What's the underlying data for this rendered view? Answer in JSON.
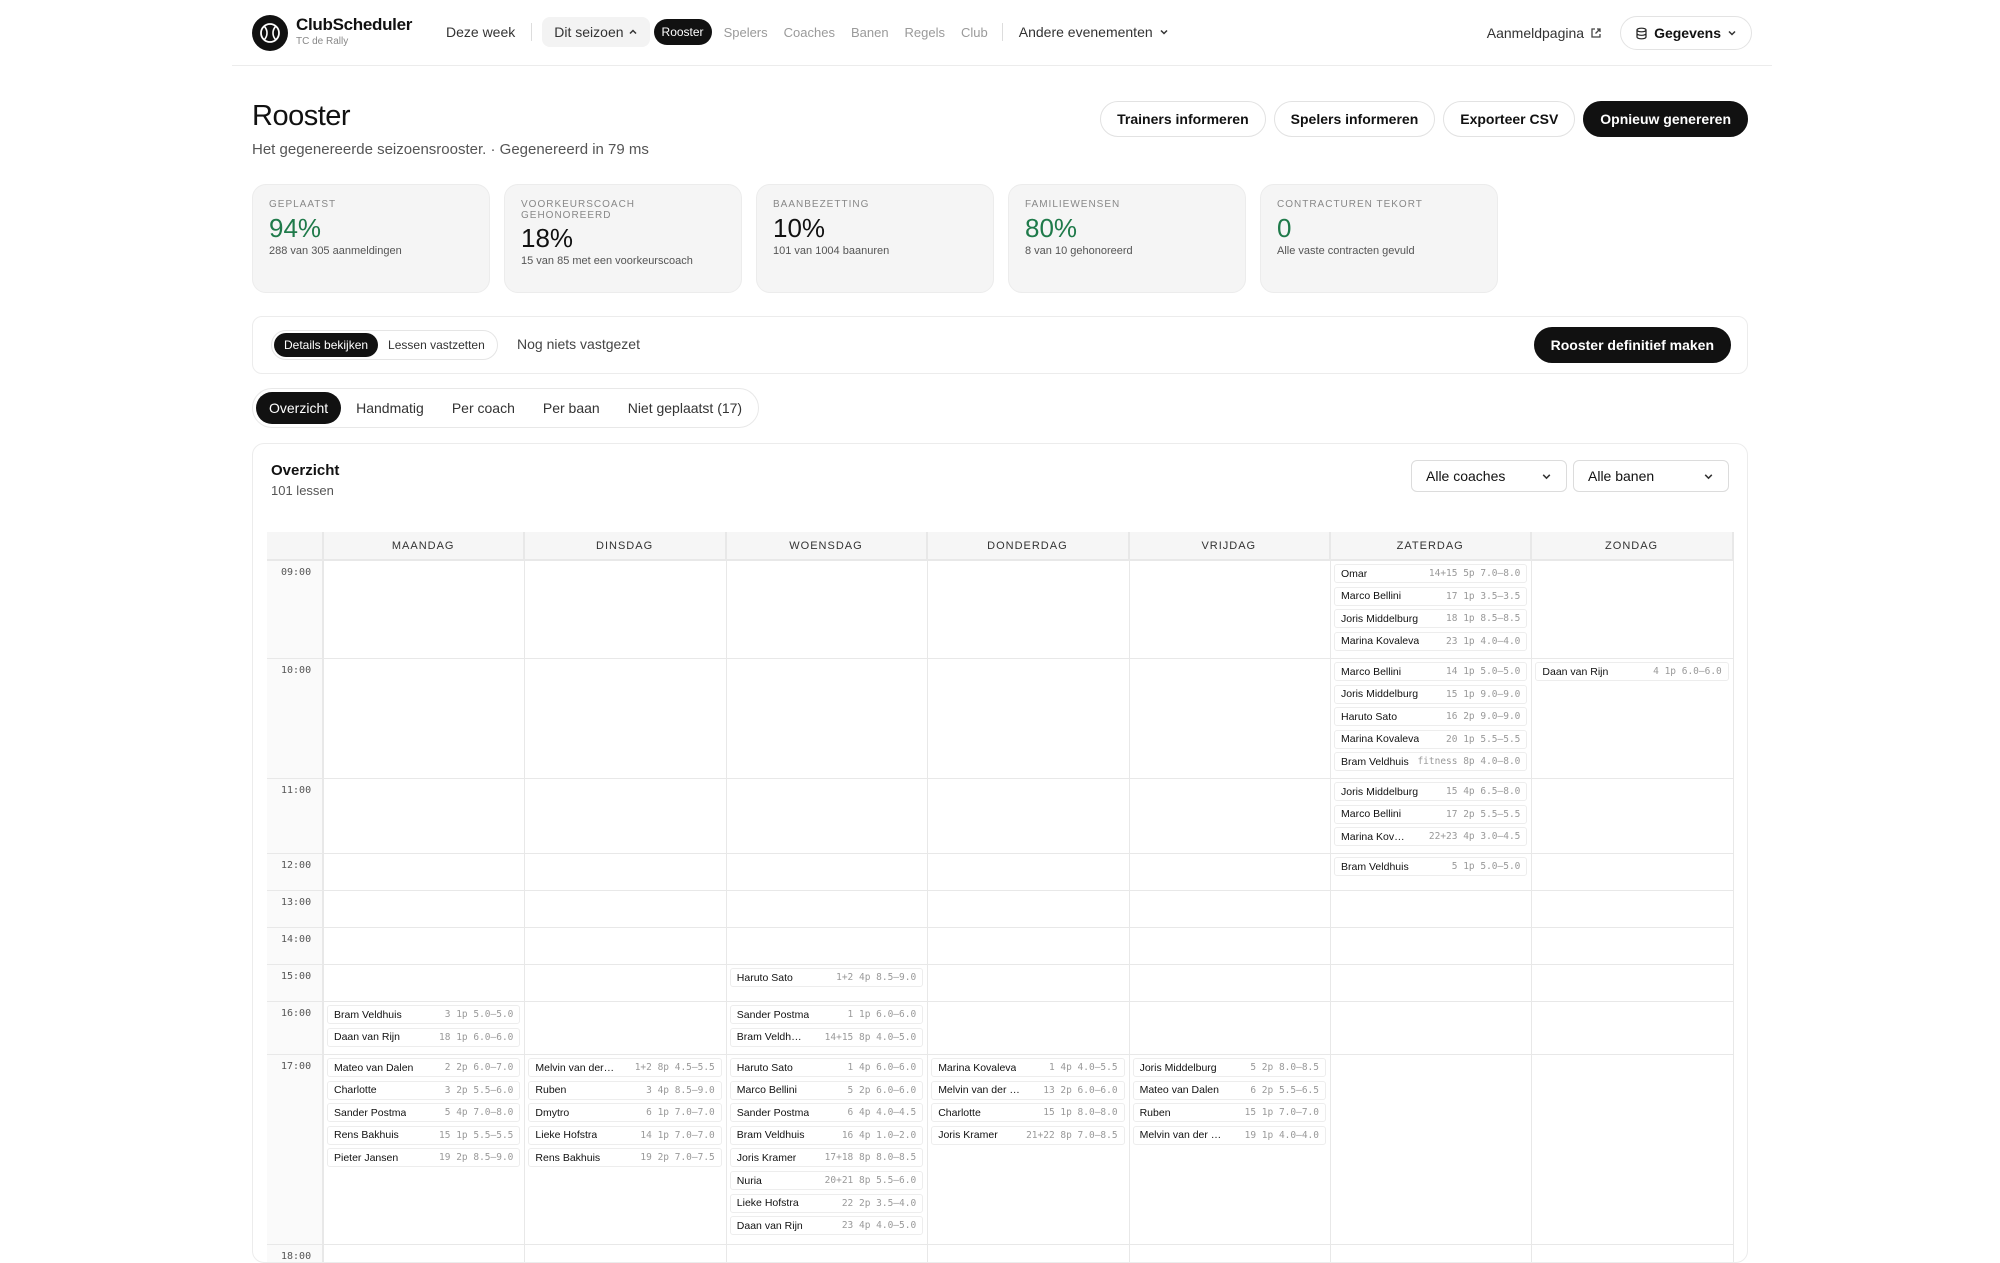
{
  "brand": {
    "name": "ClubScheduler",
    "sub": "TC de Rally"
  },
  "nav": {
    "this_week": "Deze week",
    "season": "Dit seizoen",
    "items": [
      "Rooster",
      "Spelers",
      "Coaches",
      "Banen",
      "Regels",
      "Club"
    ],
    "other_events": "Andere evenementen",
    "signup_page": "Aanmeldpagina",
    "data": "Gegevens"
  },
  "page": {
    "title": "Rooster",
    "subtitle": "Het gegenereerde seizoensrooster. · Gegenereerd in 79 ms",
    "actions": [
      "Trainers informeren",
      "Spelers informeren",
      "Exporteer CSV",
      "Opnieuw genereren"
    ]
  },
  "stats": [
    {
      "label": "Geplaatst",
      "value": "94%",
      "desc": "288 van 305 aanmeldingen",
      "color": "#1f7a4a"
    },
    {
      "label": "Voorkeurscoach gehonoreerd",
      "value": "18%",
      "desc": "15 van 85 met een voorkeurscoach",
      "color": "#111111"
    },
    {
      "label": "Baanbezetting",
      "value": "10%",
      "desc": "101 van 1004 baanuren",
      "color": "#111111"
    },
    {
      "label": "Familiewensen",
      "value": "80%",
      "desc": "8 van 10 gehonoreerd",
      "color": "#1f7a4a"
    },
    {
      "label": "Contracturen tekort",
      "value": "0",
      "desc": "Alle vaste contracten gevuld",
      "color": "#1f7a4a"
    }
  ],
  "lockbar": {
    "modes": [
      "Details bekijken",
      "Lessen vastzetten"
    ],
    "status": "Nog niets vastgezet",
    "finalize": "Rooster definitief maken"
  },
  "tabs": [
    "Overzicht",
    "Handmatig",
    "Per coach",
    "Per baan",
    "Niet geplaatst (17)"
  ],
  "overview": {
    "title": "Overzicht",
    "count": "101 lessen",
    "filter_coach": "Alle coaches",
    "filter_court": "Alle banen"
  },
  "calendar": {
    "days": [
      "MAANDAG",
      "DINSDAG",
      "WOENSDAG",
      "DONDERDAG",
      "VRIJDAG",
      "ZATERDAG",
      "ZONDAG"
    ],
    "times": [
      "09:00",
      "10:00",
      "11:00",
      "12:00",
      "13:00",
      "14:00",
      "15:00",
      "16:00",
      "17:00",
      "18:00"
    ],
    "lessons": [
      {
        "day": 5,
        "time": 0,
        "coach": "Omar",
        "meta": "14+15 5p 7.0–8.0"
      },
      {
        "day": 5,
        "time": 0,
        "coach": "Marco Bellini",
        "meta": "17 1p 3.5–3.5"
      },
      {
        "day": 5,
        "time": 0,
        "coach": "Joris Middelburg",
        "meta": "18 1p 8.5–8.5"
      },
      {
        "day": 5,
        "time": 0,
        "coach": "Marina Kovaleva",
        "meta": "23 1p 4.0–4.0"
      },
      {
        "day": 5,
        "time": 1,
        "coach": "Marco Bellini",
        "meta": "14 1p 5.0–5.0"
      },
      {
        "day": 5,
        "time": 1,
        "coach": "Joris Middelburg",
        "meta": "15 1p 9.0–9.0"
      },
      {
        "day": 5,
        "time": 1,
        "coach": "Haruto Sato",
        "meta": "16 2p 9.0–9.0"
      },
      {
        "day": 5,
        "time": 1,
        "coach": "Marina Kovaleva",
        "meta": "20 1p 5.5–5.5"
      },
      {
        "day": 5,
        "time": 1,
        "coach": "Bram Veldhuis",
        "meta": "fitness 8p 4.0–8.0"
      },
      {
        "day": 6,
        "time": 1,
        "coach": "Daan van Rijn",
        "meta": "4 1p 6.0–6.0"
      },
      {
        "day": 5,
        "time": 2,
        "coach": "Joris Middelburg",
        "meta": "15 4p 6.5–8.0"
      },
      {
        "day": 5,
        "time": 2,
        "coach": "Marco Bellini",
        "meta": "17 2p 5.5–5.5"
      },
      {
        "day": 5,
        "time": 2,
        "coach": "Marina Kov…",
        "meta": "22+23 4p 3.0–4.5"
      },
      {
        "day": 5,
        "time": 3,
        "coach": "Bram Veldhuis",
        "meta": "5 1p 5.0–5.0"
      },
      {
        "day": 2,
        "time": 6,
        "coach": "Haruto Sato",
        "meta": "1+2 4p 8.5–9.0"
      },
      {
        "day": 0,
        "time": 7,
        "coach": "Bram Veldhuis",
        "meta": "3 1p 5.0–5.0"
      },
      {
        "day": 0,
        "time": 7,
        "coach": "Daan van Rijn",
        "meta": "18 1p 6.0–6.0"
      },
      {
        "day": 2,
        "time": 7,
        "coach": "Sander Postma",
        "meta": "1 1p 6.0–6.0"
      },
      {
        "day": 2,
        "time": 7,
        "coach": "Bram Veldh…",
        "meta": "14+15 8p 4.0–5.0"
      },
      {
        "day": 0,
        "time": 8,
        "coach": "Mateo van Dalen",
        "meta": "2 2p 6.0–7.0"
      },
      {
        "day": 0,
        "time": 8,
        "coach": "Charlotte",
        "meta": "3 2p 5.5–6.0"
      },
      {
        "day": 0,
        "time": 8,
        "coach": "Sander Postma",
        "meta": "5 4p 7.0–8.0"
      },
      {
        "day": 0,
        "time": 8,
        "coach": "Rens Bakhuis",
        "meta": "15 1p 5.5–5.5"
      },
      {
        "day": 0,
        "time": 8,
        "coach": "Pieter Jansen",
        "meta": "19 2p 8.5–9.0"
      },
      {
        "day": 1,
        "time": 8,
        "coach": "Melvin van der…",
        "meta": "1+2 8p 4.5–5.5"
      },
      {
        "day": 1,
        "time": 8,
        "coach": "Ruben",
        "meta": "3 4p 8.5–9.0"
      },
      {
        "day": 1,
        "time": 8,
        "coach": "Dmytro",
        "meta": "6 1p 7.0–7.0"
      },
      {
        "day": 1,
        "time": 8,
        "coach": "Lieke Hofstra",
        "meta": "14 1p 7.0–7.0"
      },
      {
        "day": 1,
        "time": 8,
        "coach": "Rens Bakhuis",
        "meta": "19 2p 7.0–7.5"
      },
      {
        "day": 2,
        "time": 8,
        "coach": "Haruto Sato",
        "meta": "1 4p 6.0–6.0"
      },
      {
        "day": 2,
        "time": 8,
        "coach": "Marco Bellini",
        "meta": "5 2p 6.0–6.0"
      },
      {
        "day": 2,
        "time": 8,
        "coach": "Sander Postma",
        "meta": "6 4p 4.0–4.5"
      },
      {
        "day": 2,
        "time": 8,
        "coach": "Bram Veldhuis",
        "meta": "16 4p 1.0–2.0"
      },
      {
        "day": 2,
        "time": 8,
        "coach": "Joris Kramer",
        "meta": "17+18 8p 8.0–8.5"
      },
      {
        "day": 2,
        "time": 8,
        "coach": "Nuria",
        "meta": "20+21 8p 5.5–6.0"
      },
      {
        "day": 2,
        "time": 8,
        "coach": "Lieke Hofstra",
        "meta": "22 2p 3.5–4.0"
      },
      {
        "day": 2,
        "time": 8,
        "coach": "Daan van Rijn",
        "meta": "23 4p 4.0–5.0"
      },
      {
        "day": 3,
        "time": 8,
        "coach": "Marina Kovaleva",
        "meta": "1 4p 4.0–5.5"
      },
      {
        "day": 3,
        "time": 8,
        "coach": "Melvin van der …",
        "meta": "13 2p 6.0–6.0"
      },
      {
        "day": 3,
        "time": 8,
        "coach": "Charlotte",
        "meta": "15 1p 8.0–8.0"
      },
      {
        "day": 3,
        "time": 8,
        "coach": "Joris Kramer",
        "meta": "21+22 8p 7.0–8.5"
      },
      {
        "day": 4,
        "time": 8,
        "coach": "Joris Middelburg",
        "meta": "5 2p 8.0–8.5"
      },
      {
        "day": 4,
        "time": 8,
        "coach": "Mateo van Dalen",
        "meta": "6 2p 5.5–6.5"
      },
      {
        "day": 4,
        "time": 8,
        "coach": "Ruben",
        "meta": "15 1p 7.0–7.0"
      },
      {
        "day": 4,
        "time": 8,
        "coach": "Melvin van der …",
        "meta": "19 1p 4.0–4.0"
      }
    ]
  }
}
